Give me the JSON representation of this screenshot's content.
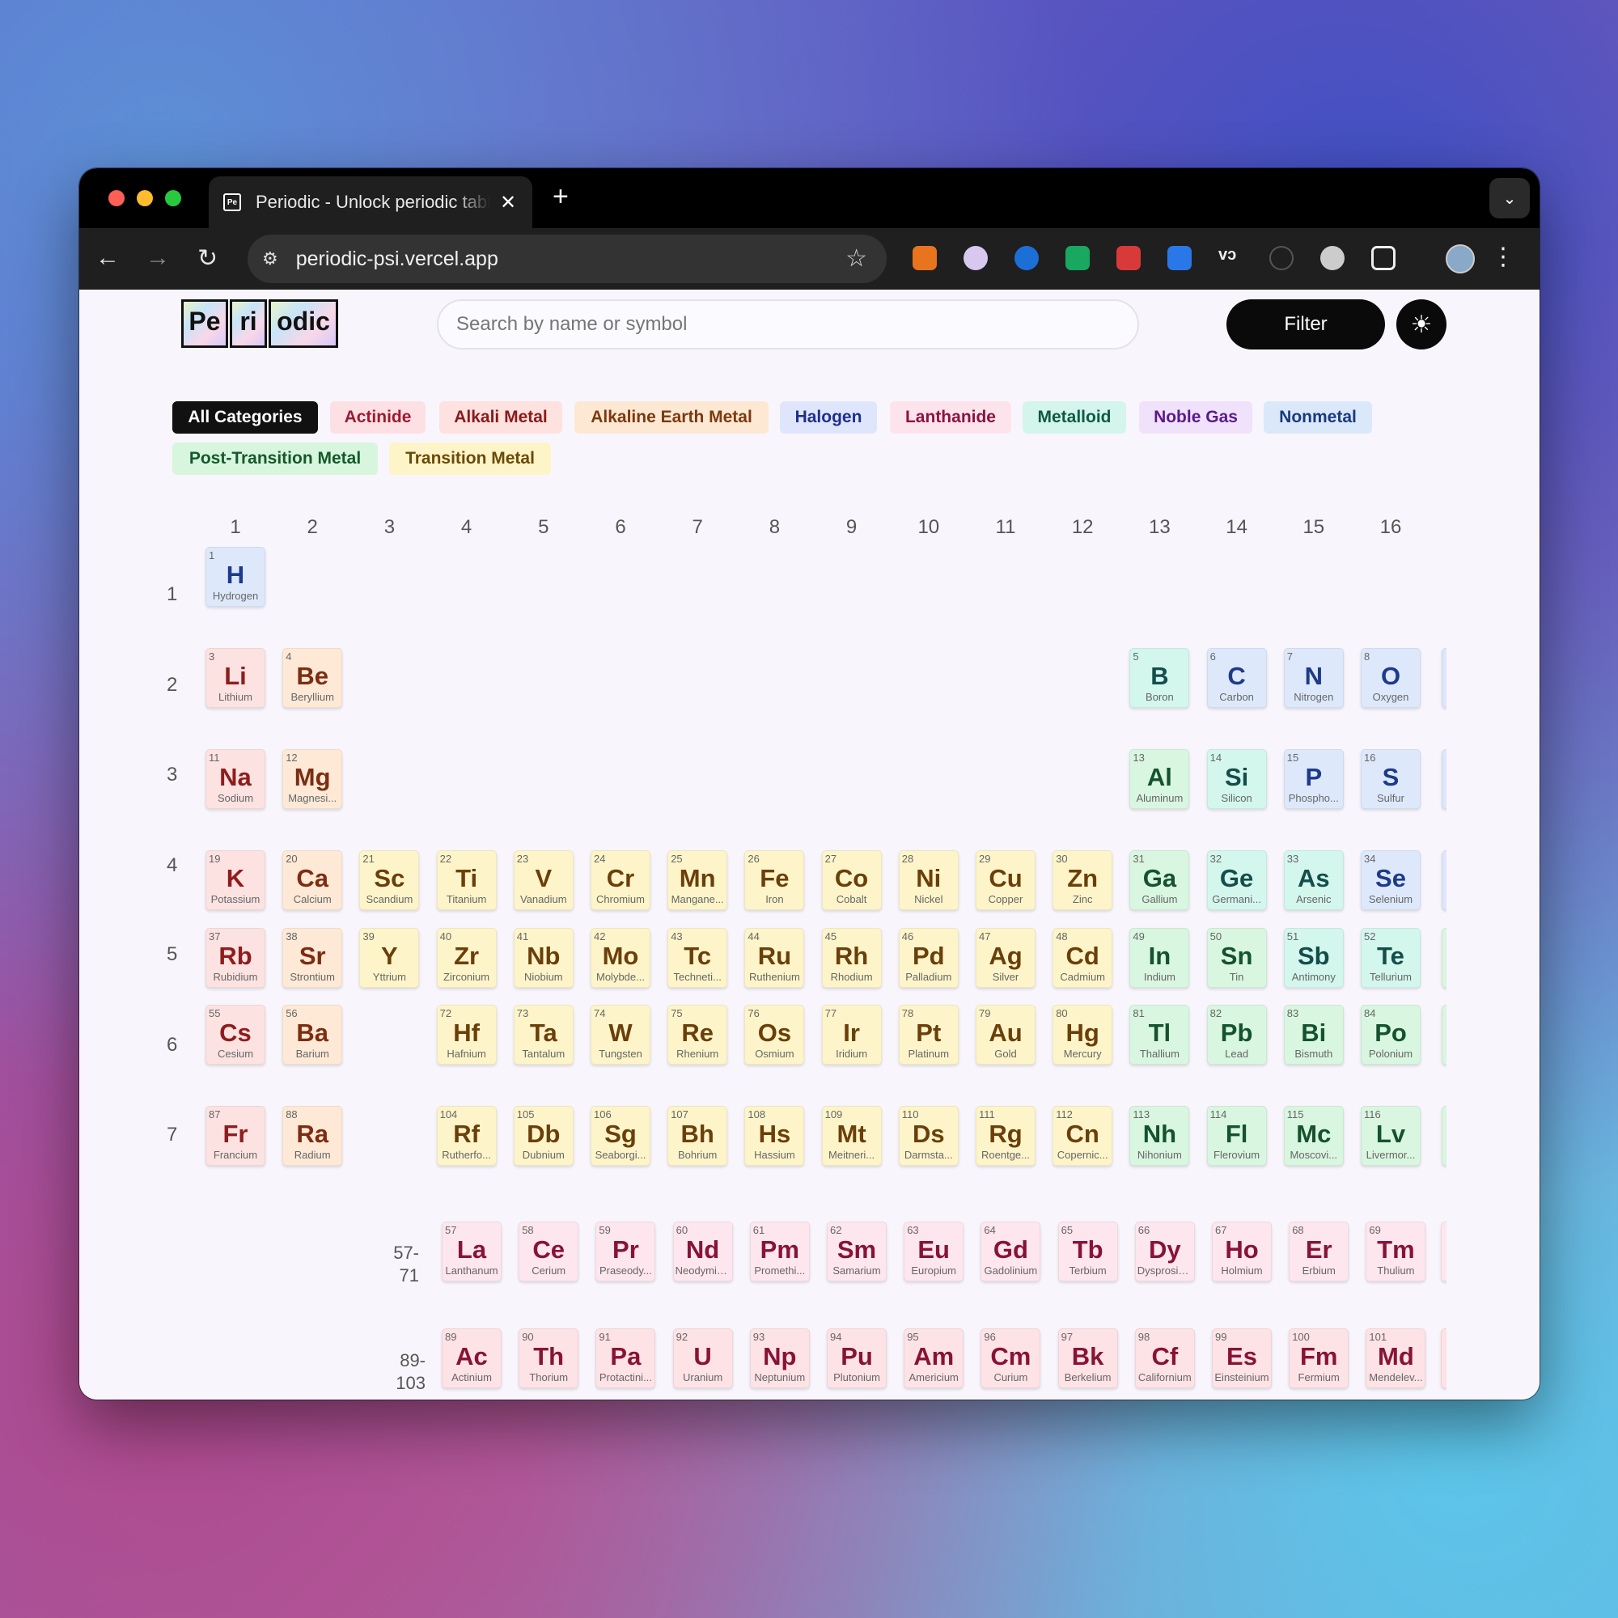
{
  "browser": {
    "tab_title": "Periodic - Unlock periodic table",
    "tab_favicon": "Pe",
    "url": "periodic-psi.vercel.app"
  },
  "logo": {
    "tiles": [
      "Pe",
      "ri",
      "odic"
    ]
  },
  "search": {
    "placeholder": "Search by name or symbol"
  },
  "filter_label": "Filter",
  "categories": [
    {
      "label": "All Categories",
      "bg": "#111111",
      "fg": "#ffffff"
    },
    {
      "label": "Actinide",
      "bg": "#fde0e4",
      "fg": "#9b1b30"
    },
    {
      "label": "Alkali Metal",
      "bg": "#fde2e0",
      "fg": "#8a1a1a"
    },
    {
      "label": "Alkaline Earth Metal",
      "bg": "#fde8d4",
      "fg": "#7a3a10"
    },
    {
      "label": "Halogen",
      "bg": "#dfe6fb",
      "fg": "#1e2f8a"
    },
    {
      "label": "Lanthanide",
      "bg": "#fde4ec",
      "fg": "#8a1440"
    },
    {
      "label": "Metalloid",
      "bg": "#d4f5ec",
      "fg": "#0d5a44"
    },
    {
      "label": "Noble Gas",
      "bg": "#efe2fa",
      "fg": "#5a1a8a"
    },
    {
      "label": "Nonmetal",
      "bg": "#dbe8fa",
      "fg": "#1a3a7a"
    },
    {
      "label": "Post-Transition Metal",
      "bg": "#d8f5de",
      "fg": "#135a2a"
    },
    {
      "label": "Transition Metal",
      "bg": "#fdf4c8",
      "fg": "#6a4a08"
    }
  ],
  "groups": [
    "1",
    "2",
    "3",
    "4",
    "5",
    "6",
    "7",
    "8",
    "9",
    "10",
    "11",
    "12",
    "13",
    "14",
    "15",
    "16"
  ],
  "periods": [
    "1",
    "2",
    "3",
    "4",
    "5",
    "6",
    "7"
  ],
  "fblock_labels": [
    "57-\n71",
    "89-\n103"
  ],
  "category_colors": {
    "nonmetal": {
      "bg": "#dde9fb",
      "fg": "#1e3a8a"
    },
    "alkali": {
      "bg": "#fde2e2",
      "fg": "#8f1d1d"
    },
    "alkaline": {
      "bg": "#fde9d6",
      "fg": "#7c2d12"
    },
    "transition": {
      "bg": "#fdf5c9",
      "fg": "#6b3f0a"
    },
    "post": {
      "bg": "#d9f6e0",
      "fg": "#14532d"
    },
    "metalloid": {
      "bg": "#d3f6ed",
      "fg": "#134e4a"
    },
    "lanthanide": {
      "bg": "#fde6ee",
      "fg": "#881337"
    },
    "actinide": {
      "bg": "#fde2e6",
      "fg": "#881337"
    }
  },
  "elements": [
    {
      "n": 1,
      "s": "H",
      "name": "Hydrogen",
      "c": "nonmetal",
      "g": 1,
      "p": 1
    },
    {
      "n": 3,
      "s": "Li",
      "name": "Lithium",
      "c": "alkali",
      "g": 1,
      "p": 2
    },
    {
      "n": 4,
      "s": "Be",
      "name": "Beryllium",
      "c": "alkaline",
      "g": 2,
      "p": 2
    },
    {
      "n": 5,
      "s": "B",
      "name": "Boron",
      "c": "metalloid",
      "g": 13,
      "p": 2
    },
    {
      "n": 6,
      "s": "C",
      "name": "Carbon",
      "c": "nonmetal",
      "g": 14,
      "p": 2
    },
    {
      "n": 7,
      "s": "N",
      "name": "Nitrogen",
      "c": "nonmetal",
      "g": 15,
      "p": 2
    },
    {
      "n": 8,
      "s": "O",
      "name": "Oxygen",
      "c": "nonmetal",
      "g": 16,
      "p": 2
    },
    {
      "n": 11,
      "s": "Na",
      "name": "Sodium",
      "c": "alkali",
      "g": 1,
      "p": 3
    },
    {
      "n": 12,
      "s": "Mg",
      "name": "Magnesi...",
      "c": "alkaline",
      "g": 2,
      "p": 3
    },
    {
      "n": 13,
      "s": "Al",
      "name": "Aluminum",
      "c": "post",
      "g": 13,
      "p": 3
    },
    {
      "n": 14,
      "s": "Si",
      "name": "Silicon",
      "c": "metalloid",
      "g": 14,
      "p": 3
    },
    {
      "n": 15,
      "s": "P",
      "name": "Phospho...",
      "c": "nonmetal",
      "g": 15,
      "p": 3
    },
    {
      "n": 16,
      "s": "S",
      "name": "Sulfur",
      "c": "nonmetal",
      "g": 16,
      "p": 3
    },
    {
      "n": 19,
      "s": "K",
      "name": "Potassium",
      "c": "alkali",
      "g": 1,
      "p": 4
    },
    {
      "n": 20,
      "s": "Ca",
      "name": "Calcium",
      "c": "alkaline",
      "g": 2,
      "p": 4
    },
    {
      "n": 21,
      "s": "Sc",
      "name": "Scandium",
      "c": "transition",
      "g": 3,
      "p": 4
    },
    {
      "n": 22,
      "s": "Ti",
      "name": "Titanium",
      "c": "transition",
      "g": 4,
      "p": 4
    },
    {
      "n": 23,
      "s": "V",
      "name": "Vanadium",
      "c": "transition",
      "g": 5,
      "p": 4
    },
    {
      "n": 24,
      "s": "Cr",
      "name": "Chromium",
      "c": "transition",
      "g": 6,
      "p": 4
    },
    {
      "n": 25,
      "s": "Mn",
      "name": "Mangane...",
      "c": "transition",
      "g": 7,
      "p": 4
    },
    {
      "n": 26,
      "s": "Fe",
      "name": "Iron",
      "c": "transition",
      "g": 8,
      "p": 4
    },
    {
      "n": 27,
      "s": "Co",
      "name": "Cobalt",
      "c": "transition",
      "g": 9,
      "p": 4
    },
    {
      "n": 28,
      "s": "Ni",
      "name": "Nickel",
      "c": "transition",
      "g": 10,
      "p": 4
    },
    {
      "n": 29,
      "s": "Cu",
      "name": "Copper",
      "c": "transition",
      "g": 11,
      "p": 4
    },
    {
      "n": 30,
      "s": "Zn",
      "name": "Zinc",
      "c": "transition",
      "g": 12,
      "p": 4
    },
    {
      "n": 31,
      "s": "Ga",
      "name": "Gallium",
      "c": "post",
      "g": 13,
      "p": 4
    },
    {
      "n": 32,
      "s": "Ge",
      "name": "Germani...",
      "c": "metalloid",
      "g": 14,
      "p": 4
    },
    {
      "n": 33,
      "s": "As",
      "name": "Arsenic",
      "c": "metalloid",
      "g": 15,
      "p": 4
    },
    {
      "n": 34,
      "s": "Se",
      "name": "Selenium",
      "c": "nonmetal",
      "g": 16,
      "p": 4
    },
    {
      "n": 37,
      "s": "Rb",
      "name": "Rubidium",
      "c": "alkali",
      "g": 1,
      "p": 5
    },
    {
      "n": 38,
      "s": "Sr",
      "name": "Strontium",
      "c": "alkaline",
      "g": 2,
      "p": 5
    },
    {
      "n": 39,
      "s": "Y",
      "name": "Yttrium",
      "c": "transition",
      "g": 3,
      "p": 5
    },
    {
      "n": 40,
      "s": "Zr",
      "name": "Zirconium",
      "c": "transition",
      "g": 4,
      "p": 5
    },
    {
      "n": 41,
      "s": "Nb",
      "name": "Niobium",
      "c": "transition",
      "g": 5,
      "p": 5
    },
    {
      "n": 42,
      "s": "Mo",
      "name": "Molybde...",
      "c": "transition",
      "g": 6,
      "p": 5
    },
    {
      "n": 43,
      "s": "Tc",
      "name": "Techneti...",
      "c": "transition",
      "g": 7,
      "p": 5
    },
    {
      "n": 44,
      "s": "Ru",
      "name": "Ruthenium",
      "c": "transition",
      "g": 8,
      "p": 5
    },
    {
      "n": 45,
      "s": "Rh",
      "name": "Rhodium",
      "c": "transition",
      "g": 9,
      "p": 5
    },
    {
      "n": 46,
      "s": "Pd",
      "name": "Palladium",
      "c": "transition",
      "g": 10,
      "p": 5
    },
    {
      "n": 47,
      "s": "Ag",
      "name": "Silver",
      "c": "transition",
      "g": 11,
      "p": 5
    },
    {
      "n": 48,
      "s": "Cd",
      "name": "Cadmium",
      "c": "transition",
      "g": 12,
      "p": 5
    },
    {
      "n": 49,
      "s": "In",
      "name": "Indium",
      "c": "post",
      "g": 13,
      "p": 5
    },
    {
      "n": 50,
      "s": "Sn",
      "name": "Tin",
      "c": "post",
      "g": 14,
      "p": 5
    },
    {
      "n": 51,
      "s": "Sb",
      "name": "Antimony",
      "c": "metalloid",
      "g": 15,
      "p": 5
    },
    {
      "n": 52,
      "s": "Te",
      "name": "Tellurium",
      "c": "metalloid",
      "g": 16,
      "p": 5
    },
    {
      "n": 55,
      "s": "Cs",
      "name": "Cesium",
      "c": "alkali",
      "g": 1,
      "p": 6
    },
    {
      "n": 56,
      "s": "Ba",
      "name": "Barium",
      "c": "alkaline",
      "g": 2,
      "p": 6
    },
    {
      "n": 72,
      "s": "Hf",
      "name": "Hafnium",
      "c": "transition",
      "g": 4,
      "p": 6
    },
    {
      "n": 73,
      "s": "Ta",
      "name": "Tantalum",
      "c": "transition",
      "g": 5,
      "p": 6
    },
    {
      "n": 74,
      "s": "W",
      "name": "Tungsten",
      "c": "transition",
      "g": 6,
      "p": 6
    },
    {
      "n": 75,
      "s": "Re",
      "name": "Rhenium",
      "c": "transition",
      "g": 7,
      "p": 6
    },
    {
      "n": 76,
      "s": "Os",
      "name": "Osmium",
      "c": "transition",
      "g": 8,
      "p": 6
    },
    {
      "n": 77,
      "s": "Ir",
      "name": "Iridium",
      "c": "transition",
      "g": 9,
      "p": 6
    },
    {
      "n": 78,
      "s": "Pt",
      "name": "Platinum",
      "c": "transition",
      "g": 10,
      "p": 6
    },
    {
      "n": 79,
      "s": "Au",
      "name": "Gold",
      "c": "transition",
      "g": 11,
      "p": 6
    },
    {
      "n": 80,
      "s": "Hg",
      "name": "Mercury",
      "c": "transition",
      "g": 12,
      "p": 6
    },
    {
      "n": 81,
      "s": "Tl",
      "name": "Thallium",
      "c": "post",
      "g": 13,
      "p": 6
    },
    {
      "n": 82,
      "s": "Pb",
      "name": "Lead",
      "c": "post",
      "g": 14,
      "p": 6
    },
    {
      "n": 83,
      "s": "Bi",
      "name": "Bismuth",
      "c": "post",
      "g": 15,
      "p": 6
    },
    {
      "n": 84,
      "s": "Po",
      "name": "Polonium",
      "c": "post",
      "g": 16,
      "p": 6
    },
    {
      "n": 87,
      "s": "Fr",
      "name": "Francium",
      "c": "alkali",
      "g": 1,
      "p": 7
    },
    {
      "n": 88,
      "s": "Ra",
      "name": "Radium",
      "c": "alkaline",
      "g": 2,
      "p": 7
    },
    {
      "n": 104,
      "s": "Rf",
      "name": "Rutherfo...",
      "c": "transition",
      "g": 4,
      "p": 7
    },
    {
      "n": 105,
      "s": "Db",
      "name": "Dubnium",
      "c": "transition",
      "g": 5,
      "p": 7
    },
    {
      "n": 106,
      "s": "Sg",
      "name": "Seaborgi...",
      "c": "transition",
      "g": 6,
      "p": 7
    },
    {
      "n": 107,
      "s": "Bh",
      "name": "Bohrium",
      "c": "transition",
      "g": 7,
      "p": 7
    },
    {
      "n": 108,
      "s": "Hs",
      "name": "Hassium",
      "c": "transition",
      "g": 8,
      "p": 7
    },
    {
      "n": 109,
      "s": "Mt",
      "name": "Meitneri...",
      "c": "transition",
      "g": 9,
      "p": 7
    },
    {
      "n": 110,
      "s": "Ds",
      "name": "Darmsta...",
      "c": "transition",
      "g": 10,
      "p": 7
    },
    {
      "n": 111,
      "s": "Rg",
      "name": "Roentge...",
      "c": "transition",
      "g": 11,
      "p": 7
    },
    {
      "n": 112,
      "s": "Cn",
      "name": "Copernic...",
      "c": "transition",
      "g": 12,
      "p": 7
    },
    {
      "n": 113,
      "s": "Nh",
      "name": "Nihonium",
      "c": "post",
      "g": 13,
      "p": 7
    },
    {
      "n": 114,
      "s": "Fl",
      "name": "Flerovium",
      "c": "post",
      "g": 14,
      "p": 7
    },
    {
      "n": 115,
      "s": "Mc",
      "name": "Moscovi...",
      "c": "post",
      "g": 15,
      "p": 7
    },
    {
      "n": 116,
      "s": "Lv",
      "name": "Livermor...",
      "c": "post",
      "g": 16,
      "p": 7
    }
  ],
  "lanthanides": [
    {
      "n": 57,
      "s": "La",
      "name": "Lanthanum"
    },
    {
      "n": 58,
      "s": "Ce",
      "name": "Cerium"
    },
    {
      "n": 59,
      "s": "Pr",
      "name": "Praseody..."
    },
    {
      "n": 60,
      "s": "Nd",
      "name": "Neodymiu..."
    },
    {
      "n": 61,
      "s": "Pm",
      "name": "Promethi..."
    },
    {
      "n": 62,
      "s": "Sm",
      "name": "Samarium"
    },
    {
      "n": 63,
      "s": "Eu",
      "name": "Europium"
    },
    {
      "n": 64,
      "s": "Gd",
      "name": "Gadolinium"
    },
    {
      "n": 65,
      "s": "Tb",
      "name": "Terbium"
    },
    {
      "n": 66,
      "s": "Dy",
      "name": "Dysprosiu..."
    },
    {
      "n": 67,
      "s": "Ho",
      "name": "Holmium"
    },
    {
      "n": 68,
      "s": "Er",
      "name": "Erbium"
    },
    {
      "n": 69,
      "s": "Tm",
      "name": "Thulium"
    }
  ],
  "actinides": [
    {
      "n": 89,
      "s": "Ac",
      "name": "Actinium"
    },
    {
      "n": 90,
      "s": "Th",
      "name": "Thorium"
    },
    {
      "n": 91,
      "s": "Pa",
      "name": "Protactini..."
    },
    {
      "n": 92,
      "s": "U",
      "name": "Uranium"
    },
    {
      "n": 93,
      "s": "Np",
      "name": "Neptunium"
    },
    {
      "n": 94,
      "s": "Pu",
      "name": "Plutonium"
    },
    {
      "n": 95,
      "s": "Am",
      "name": "Americium"
    },
    {
      "n": 96,
      "s": "Cm",
      "name": "Curium"
    },
    {
      "n": 97,
      "s": "Bk",
      "name": "Berkelium"
    },
    {
      "n": 98,
      "s": "Cf",
      "name": "Californium"
    },
    {
      "n": 99,
      "s": "Es",
      "name": "Einsteinium"
    },
    {
      "n": 100,
      "s": "Fm",
      "name": "Fermium"
    },
    {
      "n": 101,
      "s": "Md",
      "name": "Mendelev..."
    }
  ]
}
